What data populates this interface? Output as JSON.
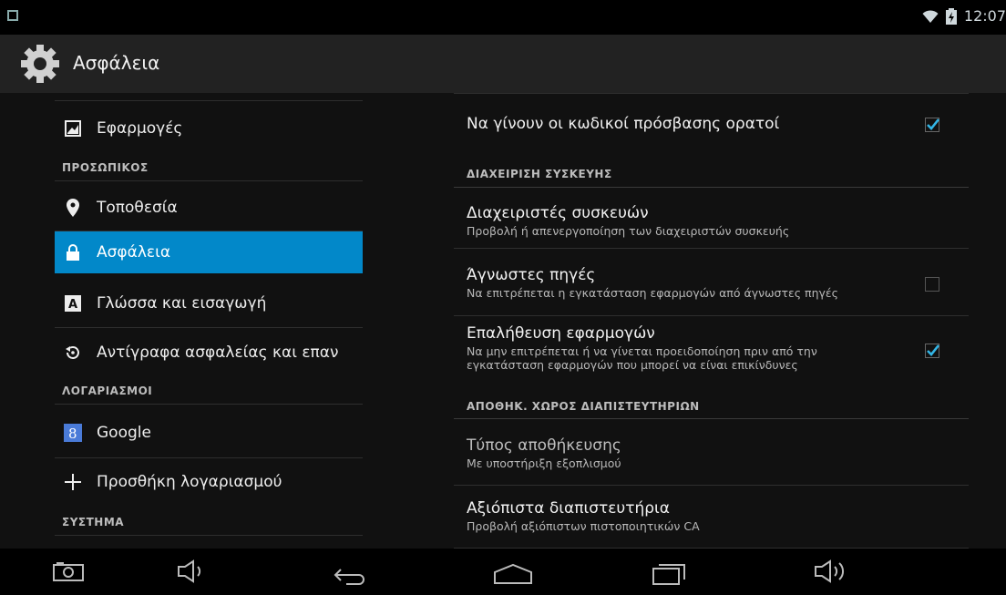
{
  "status_bar": {
    "time": "12:07"
  },
  "action_bar": {
    "title": "Ασφάλεια"
  },
  "left_nav": {
    "items_top": [
      {
        "label": "Εφαρμογές",
        "icon": "apps-icon"
      }
    ],
    "section_personal": "ΠΡΟΣΩΠΙΚΟΣ",
    "items_personal": [
      {
        "label": "Τοποθεσία",
        "icon": "location-pin-icon"
      },
      {
        "label": "Ασφάλεια",
        "icon": "lock-icon",
        "selected": true
      },
      {
        "label": "Γλώσσα και εισαγωγή",
        "icon": "keyboard-a-icon"
      },
      {
        "label": "Αντίγραφα ασφαλείας και επαν",
        "icon": "backup-restore-icon"
      }
    ],
    "section_accounts": "ΛΟΓΑΡΙΑΣΜΟΙ",
    "items_accounts": [
      {
        "label": "Google",
        "icon": "google-icon"
      },
      {
        "label": "Προσθήκη λογαριασμού",
        "icon": "plus-icon"
      }
    ],
    "section_system": "ΣΥΣΤΗΜΑ"
  },
  "settings": {
    "show_passwords": {
      "title": "Να γίνουν οι κωδικοί πρόσβασης ορατοί",
      "checked": true
    },
    "section_device_admin": "ΔΙΑΧΕΙΡΙΣΗ ΣΥΣΚΕΥΗΣ",
    "device_admins": {
      "title": "Διαχειριστές συσκευών",
      "summary": "Προβολή ή απενεργοποίηση των διαχειριστών συσκευής"
    },
    "unknown_sources": {
      "title": "Άγνωστες πηγές",
      "summary": "Να επιτρέπεται η εγκατάσταση εφαρμογών από άγνωστες πηγές",
      "checked": false
    },
    "verify_apps": {
      "title": "Επαλήθευση εφαρμογών",
      "summary_line1": "Να μην επιτρέπεται ή να γίνεται προειδοποίηση πριν από την",
      "summary_line2": "εγκατάσταση εφαρμογών που μπορεί να είναι επικίνδυνες",
      "checked": true
    },
    "section_credential_storage": "ΑΠΟΘΗΚ. ΧΩΡΟΣ ΔΙΑΠΙΣΤΕΥΤΗΡΙΩΝ",
    "storage_type": {
      "title": "Τύπος αποθήκευσης",
      "summary": "Με υποστήριξη εξοπλισμού"
    },
    "trusted_credentials": {
      "title": "Αξιόπιστα διαπιστευτήρια",
      "summary": "Προβολή αξιόπιστων πιστοποιητικών CA"
    }
  },
  "colors": {
    "accent": "#0288c9",
    "check": "#33b5e5"
  }
}
